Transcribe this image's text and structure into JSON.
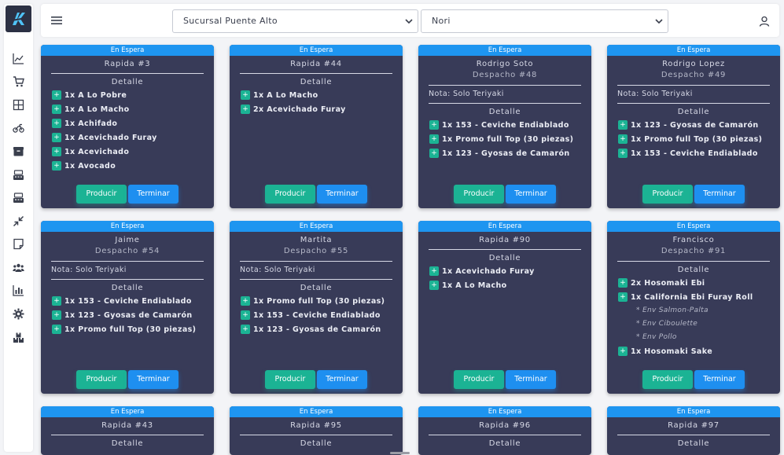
{
  "topbar": {
    "branch": "Sucursal Puente Alto",
    "station": "Nori"
  },
  "colors": {
    "card_bg": "#383b58",
    "status_bg": "#1e95f0",
    "produce": "#1bb394",
    "finish": "#1e8ff0"
  },
  "sidebar_icons": [
    "chart-line-icon",
    "cart-icon",
    "grid-icon",
    "motorcycle-icon",
    "box-icon",
    "cash-register-icon",
    "cash-register-2-icon",
    "compress-icon",
    "note-icon",
    "users-icon",
    "report-icon",
    "gear-icon",
    "boxes-icon"
  ],
  "buttons": {
    "produce": "Producir",
    "finish": "Terminar"
  },
  "detalle_label": "Detalle",
  "cards": [
    {
      "status": "En Espera",
      "title": "Rapida #3",
      "sub": "",
      "note": "",
      "items": [
        {
          "t": "1x A Lo Pobre"
        },
        {
          "t": "1x A Lo Macho"
        },
        {
          "t": "1x Achifado"
        },
        {
          "t": "1x Acevichado Furay"
        },
        {
          "t": "1x Acevichado"
        },
        {
          "t": "1x Avocado"
        }
      ]
    },
    {
      "status": "En Espera",
      "title": "Rapida #44",
      "sub": "",
      "note": "",
      "items": [
        {
          "t": "1x A Lo Macho"
        },
        {
          "t": "2x Acevichado Furay"
        }
      ]
    },
    {
      "status": "En Espera",
      "title": "Rodrigo Soto",
      "sub": "Despacho #48",
      "note": "Nota: Solo Teriyaki",
      "items": [
        {
          "t": "1x 153 - Ceviche Endiablado"
        },
        {
          "t": "1x Promo full Top (30 piezas)"
        },
        {
          "t": "1x 123 - Gyosas de Camarón"
        }
      ]
    },
    {
      "status": "En Espera",
      "title": "Rodrigo Lopez",
      "sub": "Despacho #49",
      "note": "Nota: Solo Teriyaki",
      "items": [
        {
          "t": "1x 123 - Gyosas de Camarón"
        },
        {
          "t": "1x Promo full Top (30 piezas)"
        },
        {
          "t": "1x 153 - Ceviche Endiablado"
        }
      ]
    },
    {
      "status": "En Espera",
      "title": "Jaime",
      "sub": "Despacho #54",
      "note": "Nota: Solo Teriyaki",
      "items": [
        {
          "t": "1x 153 - Ceviche Endiablado"
        },
        {
          "t": "1x 123 - Gyosas de Camarón"
        },
        {
          "t": "1x Promo full Top (30 piezas)"
        }
      ]
    },
    {
      "status": "En Espera",
      "title": "Martita",
      "sub": "Despacho #55",
      "note": "Nota: Solo Teriyaki",
      "items": [
        {
          "t": "1x Promo full Top (30 piezas)"
        },
        {
          "t": "1x 153 - Ceviche Endiablado"
        },
        {
          "t": "1x 123 - Gyosas de Camarón"
        }
      ]
    },
    {
      "status": "En Espera",
      "title": "Rapida #90",
      "sub": "",
      "note": "",
      "items": [
        {
          "t": "1x Acevichado Furay"
        },
        {
          "t": "1x A Lo Macho"
        }
      ]
    },
    {
      "status": "En Espera",
      "title": "Francisco",
      "sub": "Despacho #91",
      "note": "",
      "items": [
        {
          "t": "2x Hosomaki Ebi"
        },
        {
          "t": "1x California Ebi Furay Roll",
          "subs": [
            "* Env Salmon-Palta",
            "* Env Ciboulette",
            "* Env Pollo"
          ]
        },
        {
          "t": "1x Hosomaki Sake"
        }
      ]
    },
    {
      "status": "En Espera",
      "title": "Rapida #43",
      "sub": "",
      "note": "",
      "items": []
    },
    {
      "status": "En Espera",
      "title": "Rapida #95",
      "sub": "",
      "note": "",
      "items": []
    },
    {
      "status": "En Espera",
      "title": "Rapida #96",
      "sub": "",
      "note": "",
      "items": []
    },
    {
      "status": "En Espera",
      "title": "Rapida #97",
      "sub": "",
      "note": "",
      "items": []
    }
  ]
}
